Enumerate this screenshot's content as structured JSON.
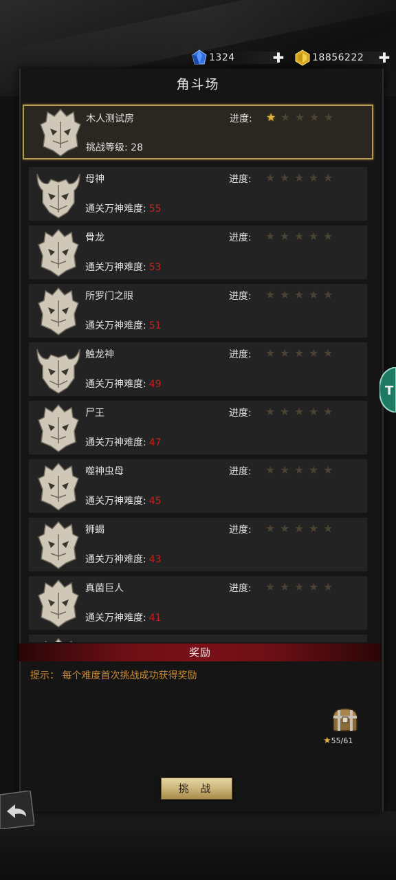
{
  "currency": {
    "gem_value": "1324",
    "gold_value": "18856222",
    "gem_icon": "blue-gem-icon",
    "gold_icon": "gold-gem-icon",
    "plus_label": "✚"
  },
  "title": "角斗场",
  "progress_label": "进度:",
  "selected": {
    "name": "木人测试房",
    "req_label": "挑战等级:",
    "req_value": "28",
    "stars": 1
  },
  "req_label": "通关万神难度:",
  "bosses": [
    {
      "name": "母神",
      "difficulty": "55",
      "mask": "horned",
      "stars": 0
    },
    {
      "name": "骨龙",
      "difficulty": "53",
      "mask": "spiked",
      "stars": 0
    },
    {
      "name": "所罗门之眼",
      "difficulty": "51",
      "mask": "spiked",
      "stars": 0
    },
    {
      "name": "触龙神",
      "difficulty": "49",
      "mask": "horned",
      "stars": 0
    },
    {
      "name": "尸王",
      "difficulty": "47",
      "mask": "spiked",
      "stars": 0
    },
    {
      "name": "噬神虫母",
      "difficulty": "45",
      "mask": "spiked",
      "stars": 0
    },
    {
      "name": "狮蝎",
      "difficulty": "43",
      "mask": "spiked",
      "stars": 0
    },
    {
      "name": "真菌巨人",
      "difficulty": "41",
      "mask": "spiked",
      "stars": 0
    }
  ],
  "reward": {
    "header": "奖励",
    "tip": "提示：  每个难度首次挑战成功获得奖励",
    "chest_icon": "treasure-chest-icon",
    "star_count": "55/61"
  },
  "challenge_button": "挑 战",
  "colors": {
    "gold_border": "#b79b4a",
    "difficulty_red": "#c4241f",
    "star_on": "#e6b43a",
    "tip_orange": "#c88a3a",
    "reward_bar": "#7a1018"
  }
}
